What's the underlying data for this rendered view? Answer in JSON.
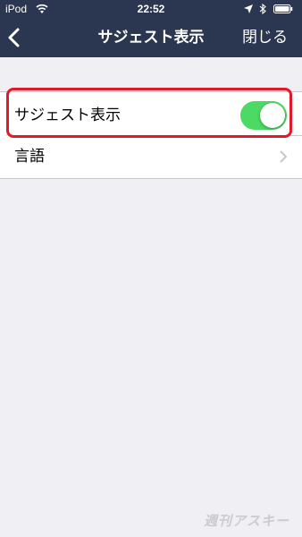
{
  "status_bar": {
    "carrier": "iPod",
    "time": "22:52"
  },
  "nav": {
    "title": "サジェスト表示",
    "close_label": "閉じる"
  },
  "settings": {
    "rows": [
      {
        "label": "サジェスト表示",
        "control": "toggle",
        "on": true
      },
      {
        "label": "言語",
        "control": "chevron"
      }
    ]
  },
  "colors": {
    "nav_background": "#2b3650",
    "toggle_on": "#4cd964",
    "highlight": "#e01a2b",
    "page_background": "#efeff4"
  },
  "watermark": "週刊アスキー"
}
